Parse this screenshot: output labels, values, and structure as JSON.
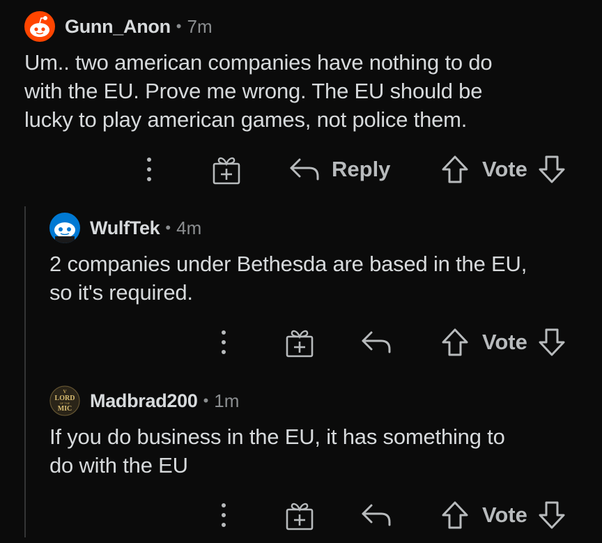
{
  "comments": [
    {
      "username": "Gunn_Anon",
      "separator": "•",
      "time": "7m",
      "body_lines": [
        "Um.. two american companies have nothing to do",
        "with the EU. Prove me wrong. The EU should be",
        "lucky to play american games, not police them."
      ],
      "reply_label": "Reply",
      "vote_label": "Vote",
      "avatar_icon": "snoo-orange-avatar"
    },
    {
      "username": "WulfTek",
      "separator": "•",
      "time": "4m",
      "body_lines": [
        "2 companies under Bethesda are based in the EU,",
        "so it's required."
      ],
      "vote_label": "Vote",
      "avatar_icon": "snoo-blue-avatar"
    },
    {
      "username": "Madbrad200",
      "separator": "•",
      "time": "1m",
      "body_lines": [
        "If you do business in the EU, it has something to",
        "do with the EU"
      ],
      "vote_label": "Vote",
      "avatar_icon": "lord-of-the-mic-avatar",
      "avatar_text": {
        "top": "V",
        "line1": "LORD",
        "line2": "OF THE",
        "line3": "MIC"
      }
    }
  ],
  "colors": {
    "background": "#0b0b0b",
    "text": "#d7dadc",
    "muted": "#8b8e90",
    "icon": "#b8bbbd",
    "thread_line": "#343536",
    "avatar_orange": "#ff4500",
    "avatar_blue": "#0079d3"
  }
}
